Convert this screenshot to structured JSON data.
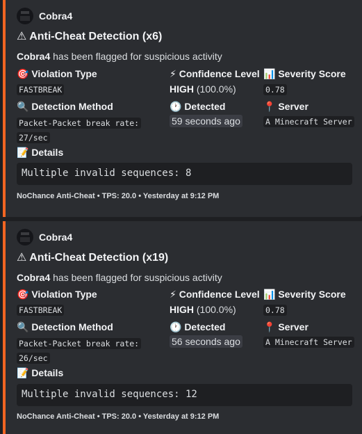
{
  "accent_color": "#f26522",
  "embeds": [
    {
      "author": "Cobra4",
      "title": "⚠ Anti-Cheat Detection (x6)",
      "player": "Cobra4",
      "description": "has been flagged for suspicious activity",
      "violation_type": {
        "icon": "target-icon",
        "label": "🎯 Violation Type",
        "value": "FASTBREAK"
      },
      "confidence": {
        "icon": "lightning-icon",
        "label": "⚡ Confidence Level",
        "level": "HIGH",
        "percent": "(100.0%)"
      },
      "severity": {
        "icon": "bar-chart-icon",
        "label": "📊 Severity Score",
        "value": "0.78"
      },
      "method": {
        "icon": "magnifier-icon",
        "label": "🔍 Detection Method",
        "line1": "Packet-Packet break rate:",
        "line2": "27/sec"
      },
      "detected": {
        "icon": "clock-icon",
        "label": "🕐 Detected",
        "value": "59 seconds ago"
      },
      "server": {
        "icon": "pin-icon",
        "label": "📍 Server",
        "value": "A Minecraft Server"
      },
      "details": {
        "icon": "memo-icon",
        "label": "📝 Details",
        "code": "Multiple invalid sequences: 8"
      },
      "footer": "NoChance Anti-Cheat • TPS: 20.0 • Yesterday at 9:12 PM"
    },
    {
      "author": "Cobra4",
      "title": "⚠ Anti-Cheat Detection (x19)",
      "player": "Cobra4",
      "description": "has been flagged for suspicious activity",
      "violation_type": {
        "icon": "target-icon",
        "label": "🎯 Violation Type",
        "value": "FASTBREAK"
      },
      "confidence": {
        "icon": "lightning-icon",
        "label": "⚡ Confidence Level",
        "level": "HIGH",
        "percent": "(100.0%)"
      },
      "severity": {
        "icon": "bar-chart-icon",
        "label": "📊 Severity Score",
        "value": "0.78"
      },
      "method": {
        "icon": "magnifier-icon",
        "label": "🔍 Detection Method",
        "line1": "Packet-Packet break rate:",
        "line2": "26/sec"
      },
      "detected": {
        "icon": "clock-icon",
        "label": "🕐 Detected",
        "value": "56 seconds ago"
      },
      "server": {
        "icon": "pin-icon",
        "label": "📍 Server",
        "value": "A Minecraft Server"
      },
      "details": {
        "icon": "memo-icon",
        "label": "📝 Details",
        "code": "Multiple invalid sequences: 12"
      },
      "footer": "NoChance Anti-Cheat • TPS: 20.0 • Yesterday at 9:12 PM"
    }
  ]
}
